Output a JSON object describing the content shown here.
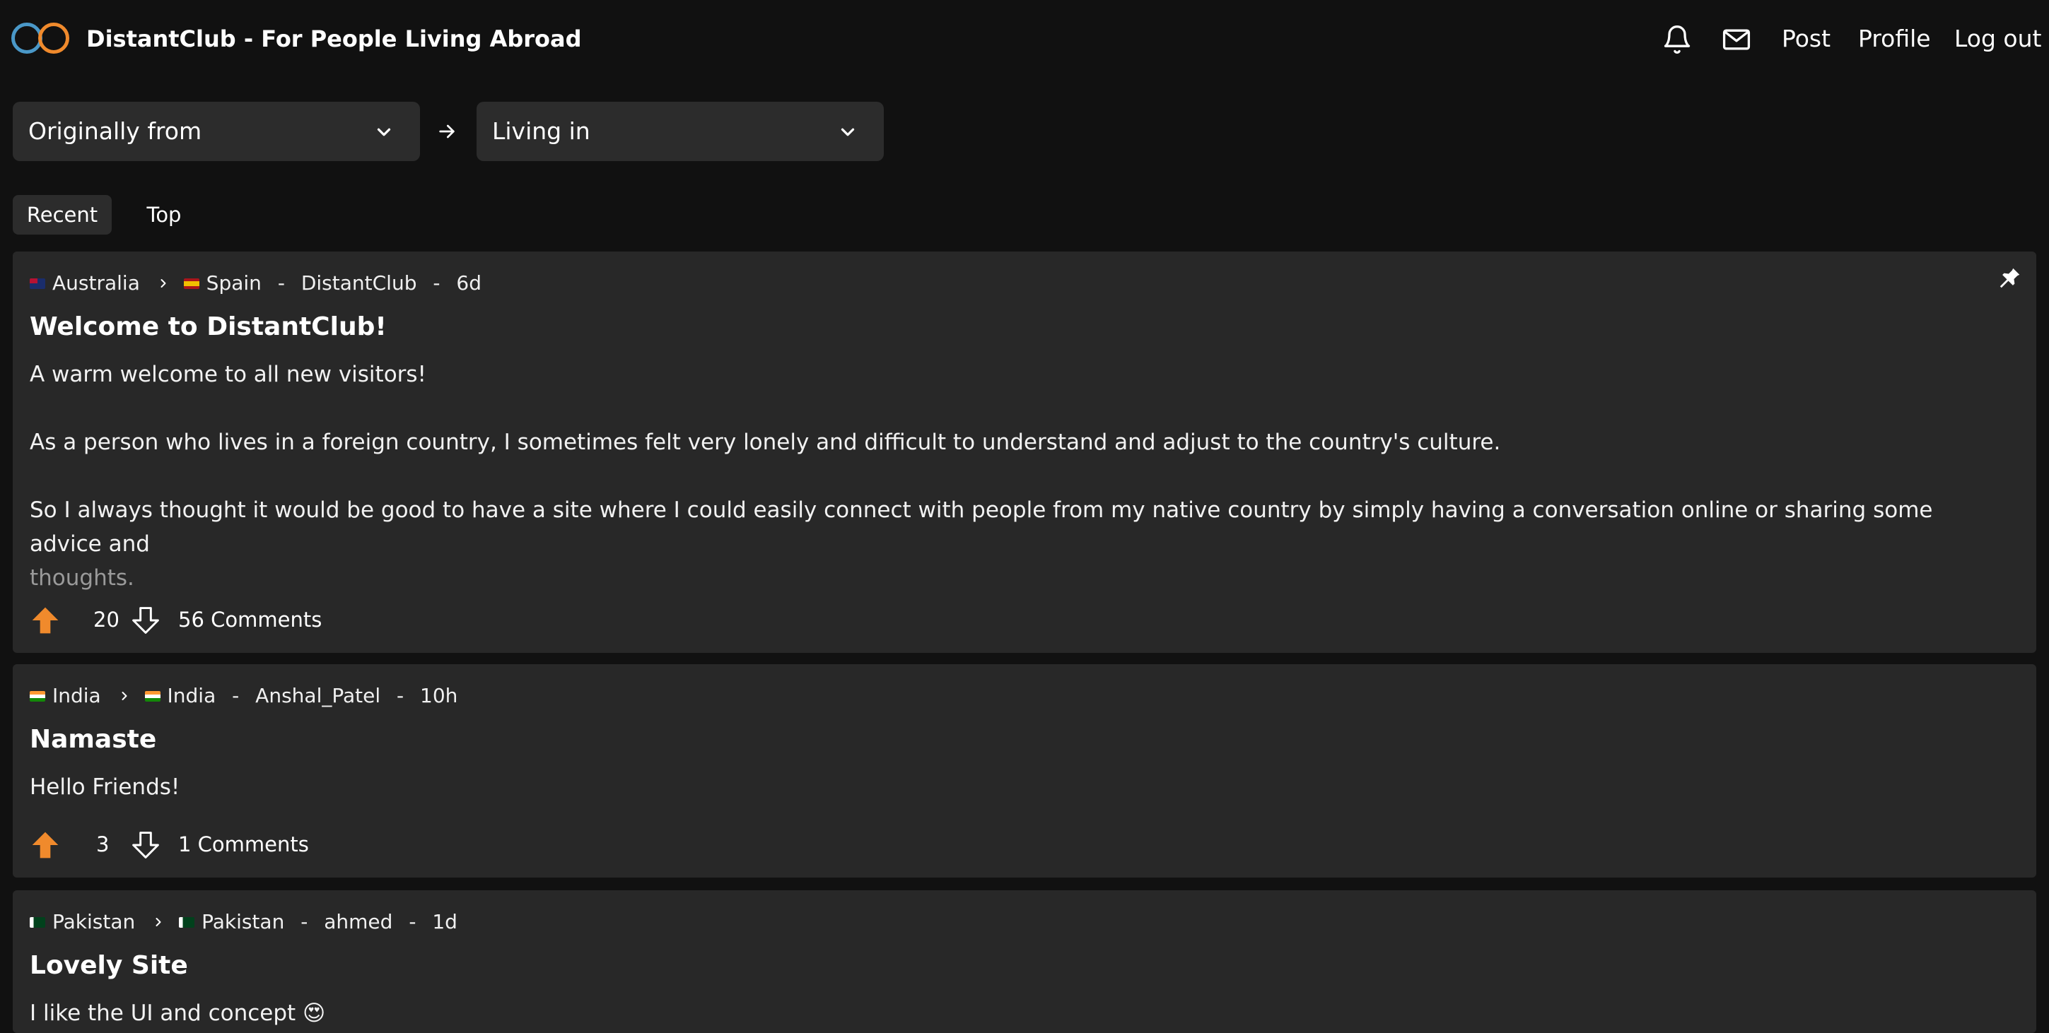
{
  "header": {
    "site_title": "DistantClub - For People Living Abroad",
    "nav": {
      "post": "Post",
      "profile": "Profile",
      "logout": "Log out"
    }
  },
  "filters": {
    "origin_placeholder": "Originally from",
    "living_placeholder": "Living in"
  },
  "tabs": {
    "recent": "Recent",
    "top": "Top",
    "active": "Recent"
  },
  "posts": [
    {
      "from_country": "Australia",
      "to_country": "Spain",
      "author": "DistantClub",
      "age": "6d",
      "title": "Welcome to DistantClub!",
      "body": [
        "A warm welcome to all new visitors!",
        "As a person who lives in a foreign country, I sometimes felt very lonely and difficult to understand and adjust to the country's culture.",
        "So I always thought it would be good to have a site where I could easily connect with people from my native country by simply having a conversation online or sharing some advice and",
        "thoughts."
      ],
      "votes": "20",
      "comments": "56 Comments",
      "pinned": true
    },
    {
      "from_country": "India",
      "to_country": "India",
      "author": "Anshal_Patel",
      "age": "10h",
      "title": "Namaste",
      "body": [
        "Hello Friends!"
      ],
      "votes": "3",
      "comments": "1 Comments",
      "pinned": false
    },
    {
      "from_country": "Pakistan",
      "to_country": "Pakistan",
      "author": "ahmed",
      "age": "1d",
      "title": "Lovely Site",
      "body": [
        "I like the UI and concept 😍"
      ],
      "pinned": false
    }
  ],
  "colors": {
    "background": "#111111",
    "card": "#282828",
    "accent": "#f08a2c",
    "logo_blue": "#4a98c8"
  }
}
